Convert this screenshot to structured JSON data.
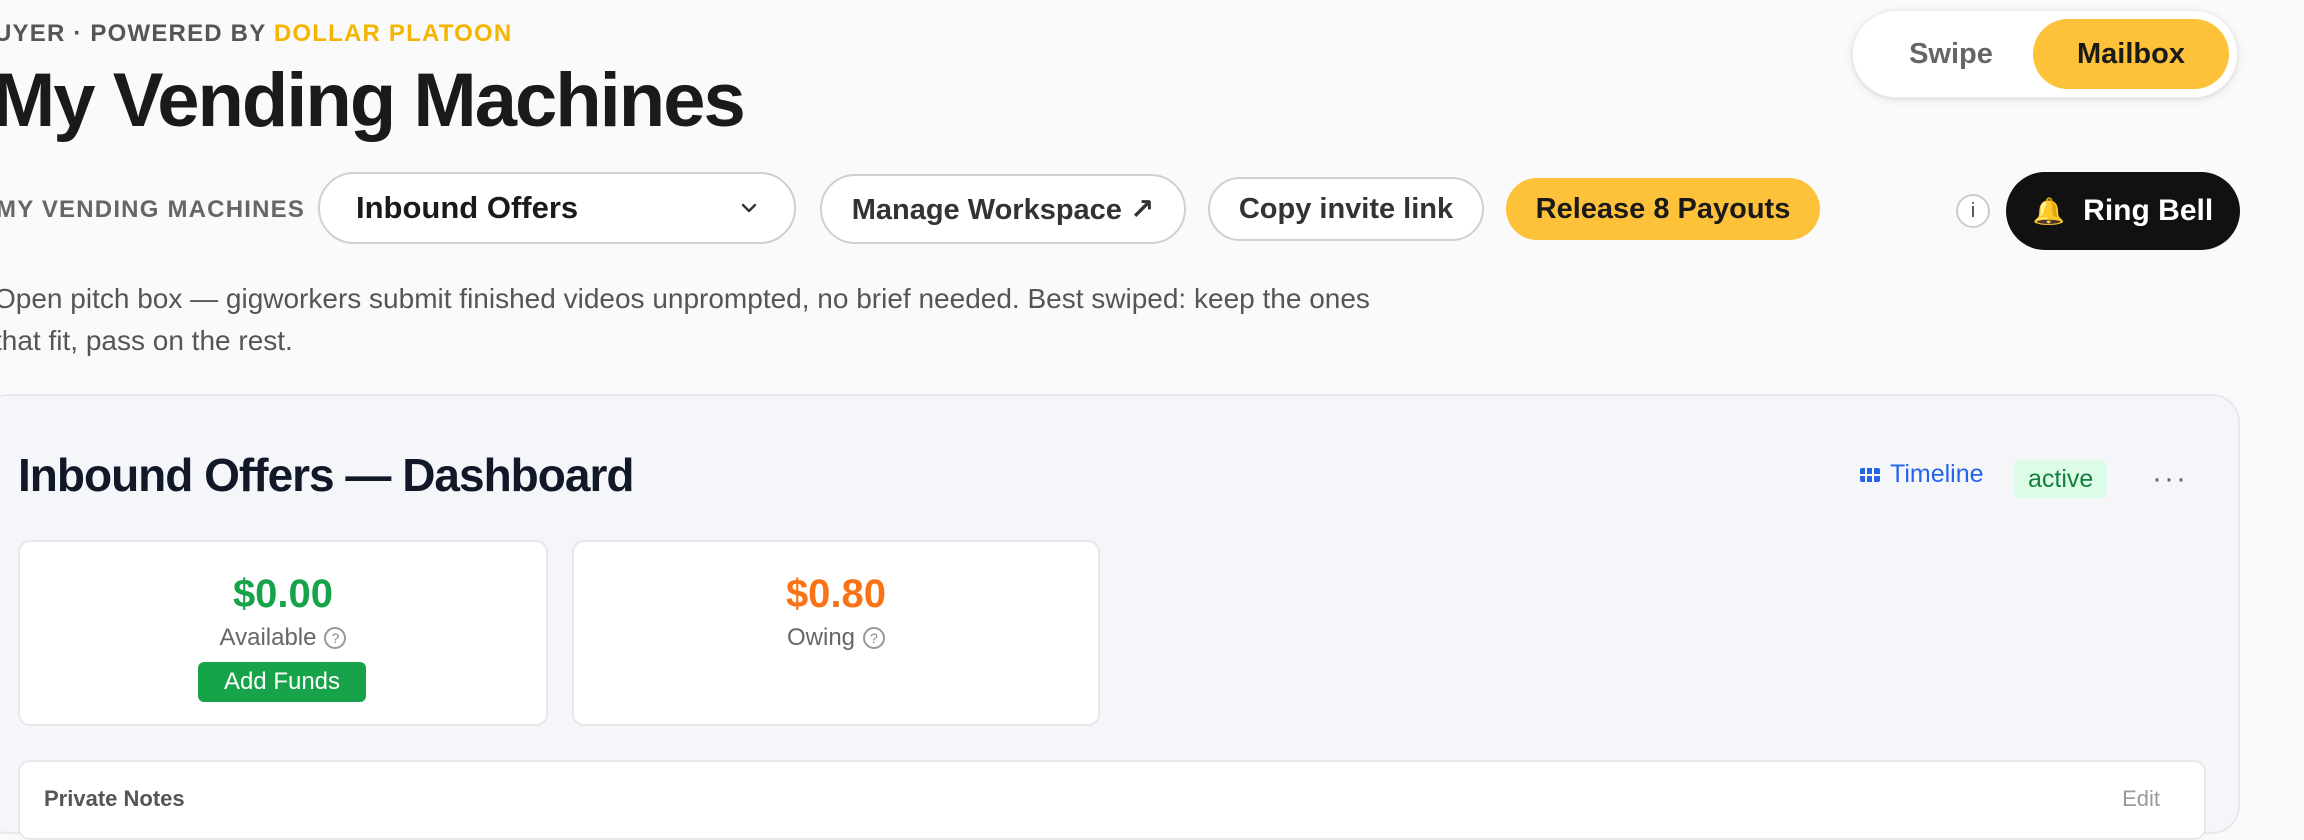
{
  "header": {
    "eyebrow_prefix": "UYER · POWERED BY",
    "brand": "DOLLAR PLATOON",
    "title": "My Vending Machines"
  },
  "view_toggle": {
    "options": [
      "Swipe",
      "Mailbox"
    ],
    "selected": "Mailbox"
  },
  "toolbar": {
    "label": "MY VENDING MACHINES",
    "select_value": "Inbound Offers",
    "manage_label": "Manage Workspace ↗",
    "copy_label": "Copy invite link",
    "release_label": "Release 8 Payouts",
    "info_label": "i",
    "bell_icon": "🔔",
    "bell_label": "Ring Bell"
  },
  "description": "Open pitch box — gigworkers submit finished videos unprompted, no brief needed. Best swiped: keep the ones that fit, pass on the rest.",
  "dashboard": {
    "title": "Inbound Offers — Dashboard",
    "timeline_label": "Timeline",
    "status": "active",
    "more": "···",
    "stats": [
      {
        "value": "$0.00",
        "label": "Available",
        "action": "Add Funds"
      },
      {
        "value": "$0.80",
        "label": "Owing"
      }
    ],
    "notes_title": "Private Notes",
    "notes_edit": "Edit"
  },
  "colors": {
    "accent": "#fdc23a",
    "brand": "#f4b400",
    "available": "#16a34a",
    "owing": "#f97316",
    "link": "#2563eb"
  }
}
